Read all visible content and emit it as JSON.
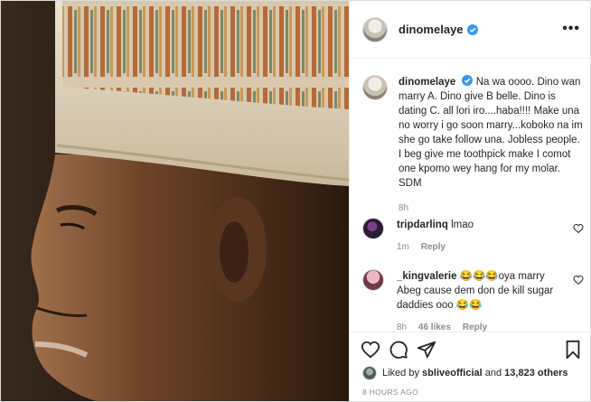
{
  "post": {
    "username": "dinomelaye",
    "caption_text": "Na wa oooo. Dino wan marry A. Dino give B belle. Dino is dating C. all lori iro....haba!!!! Make una no worry i go soon marry...koboko na im she go take follow una. Jobless people. I beg give me toothpick make I comot one kpomo wey hang for my molar. SDM",
    "caption_time": "8h",
    "more_label": "•••"
  },
  "comments": [
    {
      "username": "tripdarlinq",
      "text": "lmao",
      "time": "1m",
      "reply_label": "Reply"
    },
    {
      "username": "_kingvalerie",
      "text": "😂😂😂oya marry Abeg cause dem don de kill sugar daddies ooo 😂😂",
      "time": "8h",
      "likes": "46 likes",
      "reply_label": "Reply"
    }
  ],
  "footer": {
    "liked_by_prefix": "Liked by",
    "liked_by_user": "sbliveofficial",
    "liked_by_and": "and",
    "liked_by_count": "13,823 others",
    "post_age": "8 HOURS AGO"
  },
  "icons": [
    "verified-badge-icon",
    "more-icon",
    "heart-icon",
    "comment-icon",
    "share-icon",
    "bookmark-icon"
  ],
  "colors": {
    "verified": "#3897f0",
    "text": "#262626",
    "muted": "#8e8e8e"
  }
}
